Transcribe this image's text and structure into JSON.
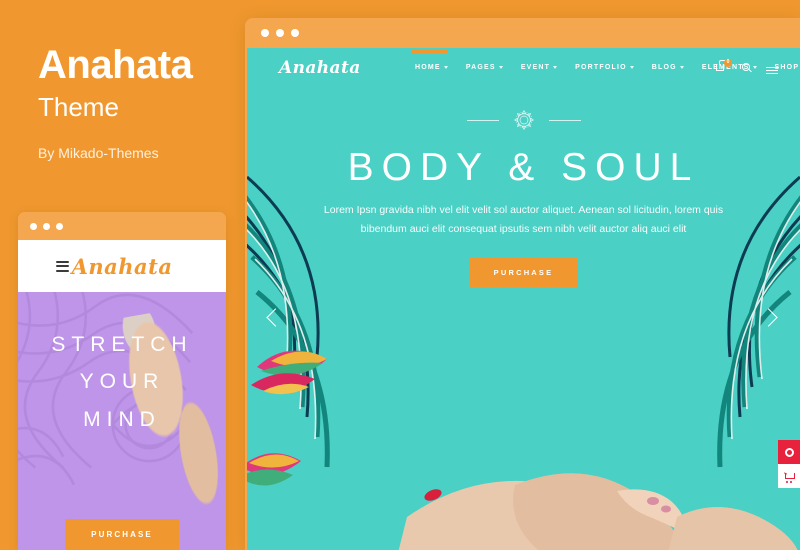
{
  "promo": {
    "title": "Anahata",
    "subtitle": "Theme",
    "author": "By Mikado-Themes"
  },
  "colors": {
    "background_orange": "#F0982F",
    "chrome_orange": "#F4A74E",
    "teal": "#4AD0C4",
    "purple": "#BE95E8",
    "accent_red": "#E8223C",
    "white": "#FFFFFF"
  },
  "browser": {
    "dots": [
      "dot-1",
      "dot-2",
      "dot-3"
    ],
    "site": {
      "logo": "Anahata",
      "menu": [
        {
          "label": "HOME",
          "has_dropdown": true,
          "active": true
        },
        {
          "label": "PAGES",
          "has_dropdown": true,
          "active": false
        },
        {
          "label": "EVENT",
          "has_dropdown": true,
          "active": false
        },
        {
          "label": "PORTFOLIO",
          "has_dropdown": true,
          "active": false
        },
        {
          "label": "BLOG",
          "has_dropdown": true,
          "active": false
        },
        {
          "label": "ELEMENTS",
          "has_dropdown": true,
          "active": false
        },
        {
          "label": "SHOP",
          "has_dropdown": true,
          "active": false
        }
      ],
      "icons": {
        "cart": "shopping-cart-icon",
        "cart_count": "0",
        "search": "search-icon",
        "menu": "hamburger-menu-icon"
      },
      "hero": {
        "ornament": "mandala-ornament-icon",
        "heading": "BODY & SOUL",
        "paragraph": "Lorem Ipsn gravida nibh vel elit velit sol auctor aliquet. Aenean sol licitudin, lorem quis bibendum auci elit consequat ipsutis sem nibh velit auctor aliq auci elit",
        "button": "PURCHASE",
        "prev_arrow": "chevron-left-icon",
        "next_arrow": "chevron-right-icon"
      },
      "side_widgets": [
        {
          "name": "theme-options-button",
          "icon": "ring-icon"
        },
        {
          "name": "cart-shortcut-button",
          "icon": "cart-icon"
        }
      ]
    }
  },
  "mobile": {
    "dots": [
      "dot-1",
      "dot-2",
      "dot-3"
    ],
    "logo": "Anahata",
    "menu_icon": "hamburger-menu-icon",
    "hero": {
      "heading_lines": [
        "STRETCH",
        "YOUR",
        "MIND"
      ],
      "button": "PURCHASE"
    }
  }
}
